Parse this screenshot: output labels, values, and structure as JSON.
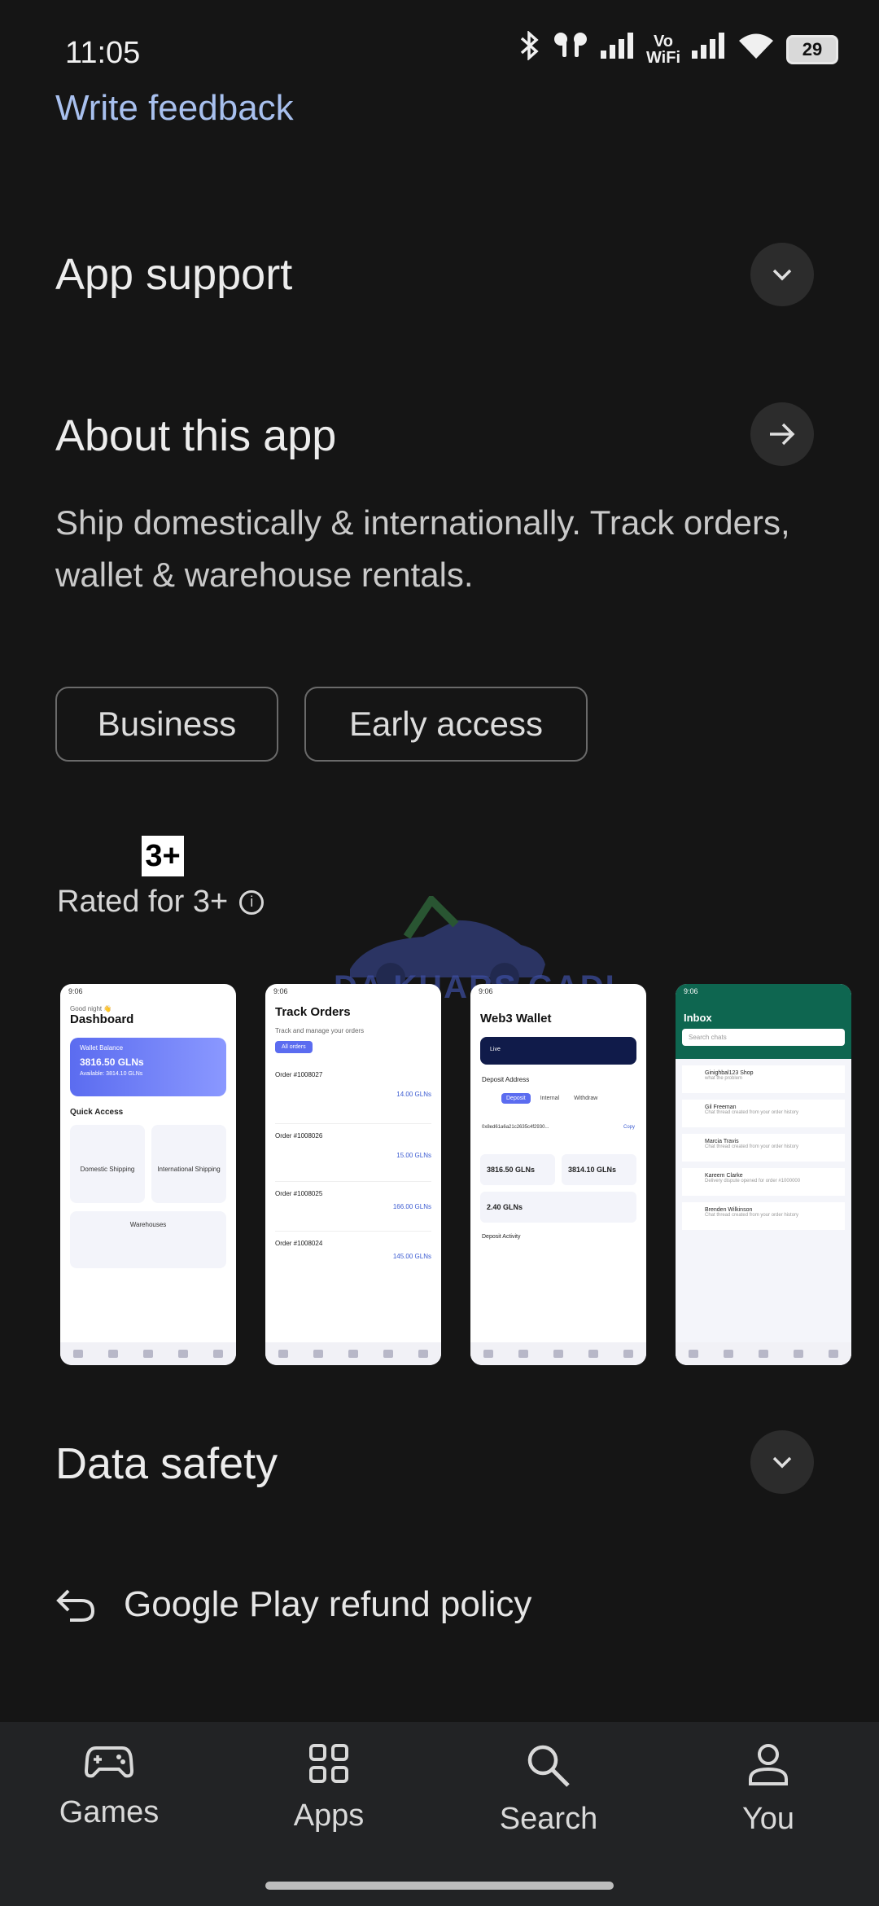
{
  "status_bar": {
    "time": "11:05",
    "battery": "29",
    "vowifi_top": "Vo",
    "vowifi_bottom": "WiFi"
  },
  "write_feedback": "Write feedback",
  "app_support": {
    "title": "App support"
  },
  "about": {
    "title": "About this app",
    "description": "Ship domestically & internationally. Track orders, wallet & warehouse rentals."
  },
  "chips": [
    "Business",
    "Early access"
  ],
  "rating": {
    "badge": "3+",
    "text": "Rated for 3+"
  },
  "watermark": "DA KHARS GADI",
  "screenshots": [
    {
      "title": "Dashboard",
      "greeting": "Good night 👋",
      "card_label": "Wallet Balance",
      "card_value": "3816.50 GLNs",
      "card_sub": "Available: 3814.10 GLNs",
      "section": "Quick Access",
      "item1": "Domestic Shipping",
      "item2": "International Shipping",
      "item3": "Warehouses"
    },
    {
      "title": "Track Orders",
      "subtitle": "Track and manage your orders",
      "filter": "All orders",
      "orders": [
        {
          "id": "Order #1008027",
          "amount": "14.00 GLNs"
        },
        {
          "id": "Order #1008026",
          "amount": "15.00 GLNs"
        },
        {
          "id": "Order #1008025",
          "amount": "166.00 GLNs"
        },
        {
          "id": "Order #1008024",
          "amount": "145.00 GLNs"
        }
      ]
    },
    {
      "title": "Web3 Wallet",
      "live": "Live",
      "deposit": "Deposit Address",
      "tabs": [
        "Deposit",
        "Internal",
        "Withdraw"
      ],
      "address": "0x8ed61a6a21c2635c4f2930...",
      "copy": "Copy",
      "bal1": "3816.50 GLNs",
      "bal2": "3814.10 GLNs",
      "locked": "2.40 GLNs",
      "activity": "Deposit Activity"
    },
    {
      "title": "Inbox",
      "search": "Search chats",
      "chats": [
        {
          "name": "Ginighbal123 Shop",
          "msg": "what the problem"
        },
        {
          "name": "Gil Freeman",
          "msg": "Chat thread created from your order history"
        },
        {
          "name": "Marcia Travis",
          "msg": "Chat thread created from your order history"
        },
        {
          "name": "Kareem Clarke",
          "msg": "Delivery dispute opened for order #1000000"
        },
        {
          "name": "Brenden Wilkinson",
          "msg": "Chat thread created from your order history"
        }
      ]
    }
  ],
  "data_safety": {
    "title": "Data safety"
  },
  "refund_policy": "Google Play refund policy",
  "nav": [
    {
      "label": "Games",
      "icon": "gamepad-icon"
    },
    {
      "label": "Apps",
      "icon": "apps-grid-icon"
    },
    {
      "label": "Search",
      "icon": "search-icon"
    },
    {
      "label": "You",
      "icon": "person-icon"
    }
  ],
  "colors": {
    "background": "#151515",
    "link": "#a8c0ee",
    "nav_bg": "#222325"
  }
}
